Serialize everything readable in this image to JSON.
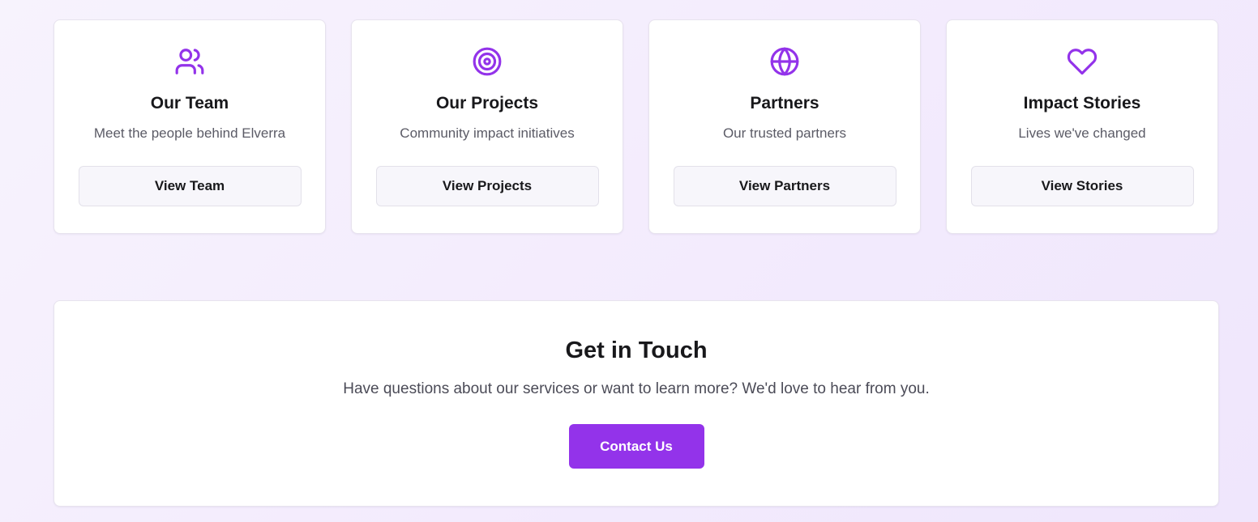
{
  "accent_color": "#9333ea",
  "cards": [
    {
      "icon": "users-icon",
      "title": "Our Team",
      "description": "Meet the people behind Elverra",
      "button_label": "View Team"
    },
    {
      "icon": "target-icon",
      "title": "Our Projects",
      "description": "Community impact initiatives",
      "button_label": "View Projects"
    },
    {
      "icon": "globe-icon",
      "title": "Partners",
      "description": "Our trusted partners",
      "button_label": "View Partners"
    },
    {
      "icon": "heart-icon",
      "title": "Impact Stories",
      "description": "Lives we've changed",
      "button_label": "View Stories"
    }
  ],
  "contact": {
    "title": "Get in Touch",
    "description": "Have questions about our services or want to learn more? We'd love to hear from you.",
    "button_label": "Contact Us"
  }
}
